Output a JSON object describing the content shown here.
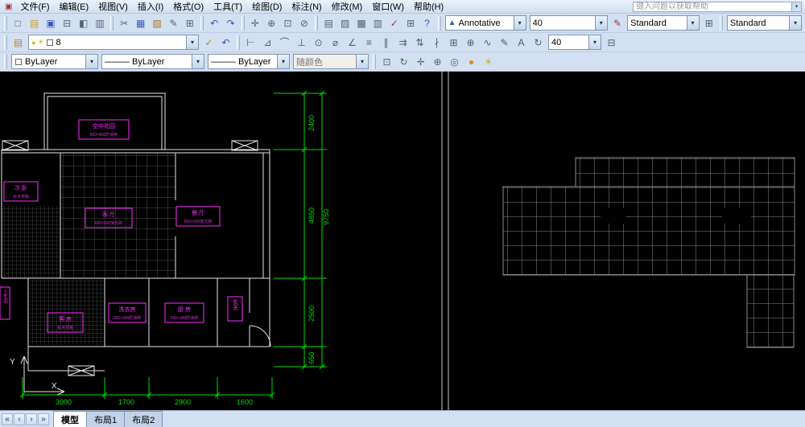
{
  "menu": {
    "logo_glyph": "▣",
    "items": [
      {
        "name": "menu-file",
        "label": "文件(F)"
      },
      {
        "name": "menu-edit",
        "label": "编辑(E)"
      },
      {
        "name": "menu-view",
        "label": "视图(V)"
      },
      {
        "name": "menu-insert",
        "label": "插入(I)"
      },
      {
        "name": "menu-format",
        "label": "格式(O)"
      },
      {
        "name": "menu-tools",
        "label": "工具(T)"
      },
      {
        "name": "menu-draw",
        "label": "绘图(D)"
      },
      {
        "name": "menu-dimension",
        "label": "标注(N)"
      },
      {
        "name": "menu-modify",
        "label": "修改(M)"
      },
      {
        "name": "menu-window",
        "label": "窗口(W)"
      },
      {
        "name": "menu-help",
        "label": "帮助(H)"
      }
    ],
    "help_input": {
      "placeholder": "键入问题以获取帮助"
    }
  },
  "icons": {
    "combo_arrow": "▾",
    "nav_first": "«",
    "nav_prev": "‹",
    "nav_next": "›",
    "nav_last": "»"
  },
  "toolbar_row1": {
    "file_icons": [
      {
        "name": "new-file-icon",
        "glyph": "□",
        "style": "color:#56617a"
      },
      {
        "name": "open-file-icon",
        "glyph": "▤",
        "style": "color:#c9a227"
      },
      {
        "name": "save-icon",
        "glyph": "▣",
        "style": "color:#3b5bb5"
      },
      {
        "name": "plot-icon",
        "glyph": "⊟",
        "style": "color:#56617a"
      },
      {
        "name": "plot-preview-icon",
        "glyph": "◧",
        "style": "color:#56617a"
      },
      {
        "name": "publish-icon",
        "glyph": "▥",
        "style": "color:#56617a"
      }
    ],
    "edit_icons": [
      {
        "name": "cut-icon",
        "glyph": "✂",
        "style": "color:#56617a"
      },
      {
        "name": "copy-icon",
        "glyph": "▦",
        "style": "color:#3b5bb5"
      },
      {
        "name": "paste-icon",
        "glyph": "▧",
        "style": "color:#a3742a"
      },
      {
        "name": "match-properties-icon",
        "glyph": "✎",
        "style": "color:#56617a"
      },
      {
        "name": "block-editor-icon",
        "glyph": "⊞",
        "style": "color:#56617a"
      }
    ],
    "undo_icons": [
      {
        "name": "undo-icon",
        "glyph": "↶",
        "style": "color:#3b5bb5"
      },
      {
        "name": "redo-icon",
        "glyph": "↷",
        "style": "color:#3b5bb5"
      }
    ],
    "view_icons": [
      {
        "name": "pan-icon",
        "glyph": "✛",
        "style": "color:#56617a"
      },
      {
        "name": "zoom-realtime-icon",
        "glyph": "⊕",
        "style": "color:#56617a"
      },
      {
        "name": "zoom-window-icon",
        "glyph": "⊡",
        "style": "color:#56617a"
      },
      {
        "name": "zoom-previous-icon",
        "glyph": "⊘",
        "style": "color:#56617a"
      }
    ],
    "palette_icons": [
      {
        "name": "properties-palette-icon",
        "glyph": "▤",
        "style": "color:#56617a"
      },
      {
        "name": "designcenter-icon",
        "glyph": "▨",
        "style": "color:#56617a"
      },
      {
        "name": "tool-palettes-icon",
        "glyph": "▩",
        "style": "color:#56617a"
      },
      {
        "name": "sheet-set-manager-icon",
        "glyph": "▥",
        "style": "color:#56617a"
      },
      {
        "name": "markup-set-manager-icon",
        "glyph": "✓",
        "style": "color:#b03a3a"
      },
      {
        "name": "quickcalc-icon",
        "glyph": "⊞",
        "style": "color:#56617a"
      },
      {
        "name": "help-icon",
        "glyph": "?",
        "style": "color:#3b5bb5"
      }
    ],
    "annotation_combo": {
      "icon": "▲",
      "value": "Annotative"
    },
    "text_height_combo": {
      "value": "40"
    },
    "brush_icon": {
      "glyph": "✎"
    },
    "text_style_combo": {
      "value": "Standard"
    },
    "table_icon": {
      "glyph": "⊞"
    },
    "mleader_style_combo": {
      "value": "Standard"
    }
  },
  "toolbar_row2": {
    "layer_manager_icon": {
      "glyph": "▤"
    },
    "layer_combo": {
      "bulb_glyph": "●",
      "sun_glyph": "☀",
      "swatch_style": "background:#ffffff",
      "value": "8"
    },
    "layer_icons": [
      {
        "name": "make-object-layer-current-icon",
        "glyph": "✓",
        "style": "color:#b38b2d"
      },
      {
        "name": "layer-previous-icon",
        "glyph": "↶",
        "style": "color:#3b5bb5"
      }
    ],
    "dim_icons": [
      {
        "name": "dim-linear-icon",
        "glyph": "⊢"
      },
      {
        "name": "dim-aligned-icon",
        "glyph": "⊿"
      },
      {
        "name": "dim-arc-length-icon",
        "glyph": "⌒"
      },
      {
        "name": "dim-ordinate-icon",
        "glyph": "⊥"
      },
      {
        "name": "dim-radius-icon",
        "glyph": "⊙"
      },
      {
        "name": "dim-diameter-icon",
        "glyph": "⌀"
      },
      {
        "name": "dim-angular-icon",
        "glyph": "∠"
      },
      {
        "name": "quick-dimension-icon",
        "glyph": "≡"
      },
      {
        "name": "dim-baseline-icon",
        "glyph": "∥"
      },
      {
        "name": "dim-continue-icon",
        "glyph": "⇉"
      },
      {
        "name": "dim-space-icon",
        "glyph": "⇅"
      },
      {
        "name": "dim-break-icon",
        "glyph": "∤"
      },
      {
        "name": "tolerance-icon",
        "glyph": "⊞"
      },
      {
        "name": "center-mark-icon",
        "glyph": "⊕"
      },
      {
        "name": "dim-jog-icon",
        "glyph": "∿"
      },
      {
        "name": "dim-edit-icon",
        "glyph": "✎"
      },
      {
        "name": "dim-text-edit-icon",
        "glyph": "A"
      },
      {
        "name": "dim-update-icon",
        "glyph": "↻"
      }
    ],
    "dim_style_combo": {
      "value": "40"
    },
    "dim_style_icons": [
      {
        "name": "dim-style-manager-icon",
        "glyph": "⊟",
        "style": "color:#56617a"
      }
    ]
  },
  "toolbar_row3": {
    "color_combo": {
      "swatch_style": "background:#ffffff",
      "value": "ByLayer"
    },
    "linetype_combo": {
      "sample": "———",
      "value": "ByLayer"
    },
    "lineweight_combo": {
      "sample": "———",
      "value": "ByLayer"
    },
    "plotstyle_combo": {
      "value": "随颜色"
    },
    "right_icons": [
      {
        "name": "draworder-icon",
        "glyph": "⊡",
        "style": "color:#56617a"
      },
      {
        "name": "3d-orbit-icon",
        "glyph": "↻",
        "style": "color:#3b7a4a"
      },
      {
        "name": "3d-pan-icon",
        "glyph": "✛",
        "style": "color:#56617a"
      },
      {
        "name": "3d-zoom-icon",
        "glyph": "⊕",
        "style": "color:#56617a"
      },
      {
        "name": "camera-icon",
        "glyph": "◎",
        "style": "color:#56617a"
      },
      {
        "name": "render-icon",
        "glyph": "●",
        "style": "color:#e08a1e"
      },
      {
        "name": "sun-properties-icon",
        "glyph": "☀",
        "style": "color:#d8b21e"
      }
    ]
  },
  "drawing": {
    "colors": {
      "wall": "#e6e6e6",
      "dim": "#00dc00",
      "label": "#ff2bff",
      "label_dim": "#cc33cc",
      "grid": "#8a8a8a"
    },
    "labels": [
      {
        "name": "空中花园",
        "spec": "800×800防滑砖"
      },
      {
        "name": "次 卧",
        "spec": "实木地板"
      },
      {
        "name": "客 厅",
        "spec": "600×600抛光砖"
      },
      {
        "name": "餐 厅",
        "spec": "600×600抛光砖"
      },
      {
        "name": "客 房",
        "spec": "实木地板"
      },
      {
        "name": "洗衣房",
        "spec": "300×300防滑砖"
      },
      {
        "name": "厨 房",
        "spec": "300×300防滑砖"
      },
      {
        "name": "玄关",
        "spec": ""
      },
      {
        "name": "卫生间",
        "spec": ""
      }
    ],
    "dims": {
      "right_top": "2400",
      "right_mid": "4850",
      "right_low": "2500",
      "right_bottom": "650",
      "right_total": "9750",
      "bottom": [
        "3000",
        "1700",
        "2900",
        "1600"
      ]
    },
    "ucs": {
      "x_label": "X",
      "y_label": "Y"
    }
  },
  "tabbar": {
    "tabs": [
      {
        "name": "tab-model",
        "label": "模型"
      },
      {
        "name": "tab-layout1",
        "label": "布局1"
      },
      {
        "name": "tab-layout2",
        "label": "布局2"
      }
    ]
  }
}
